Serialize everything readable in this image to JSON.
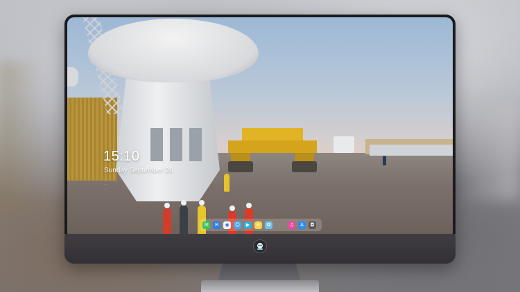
{
  "lock_screen": {
    "time": "15:10",
    "date": "Sunday September 28",
    "note_line1": "...",
    "note_line2": "..."
  },
  "dock": {
    "apps": [
      {
        "name": "messages-icon",
        "color": "#3cc85a",
        "glyph": "✉"
      },
      {
        "name": "mail-icon",
        "color": "#2f7de1",
        "glyph": "✉"
      },
      {
        "name": "safari-icon",
        "color": "#f4f4f4",
        "glyph": "◉"
      },
      {
        "name": "finder-icon",
        "color": "#4aa6ee",
        "glyph": "☺"
      },
      {
        "name": "video-icon",
        "color": "#1fb6d8",
        "glyph": "▶"
      },
      {
        "name": "notes-icon",
        "color": "#f7d34a",
        "glyph": "≡"
      },
      {
        "name": "photos-icon",
        "color": "#6fc2e6",
        "glyph": "✿"
      },
      {
        "name": "music-icon",
        "color": "#e94b9a",
        "glyph": "♫"
      },
      {
        "name": "app-store-icon",
        "color": "#2d8cf0",
        "glyph": "A"
      },
      {
        "name": "camera-icon",
        "color": "#5a5a5e",
        "glyph": "◘"
      }
    ]
  },
  "theme": {
    "bezel_color": "#1b1b1d",
    "chin_color": "#3a383d",
    "stand_color": "#6b6b70"
  }
}
